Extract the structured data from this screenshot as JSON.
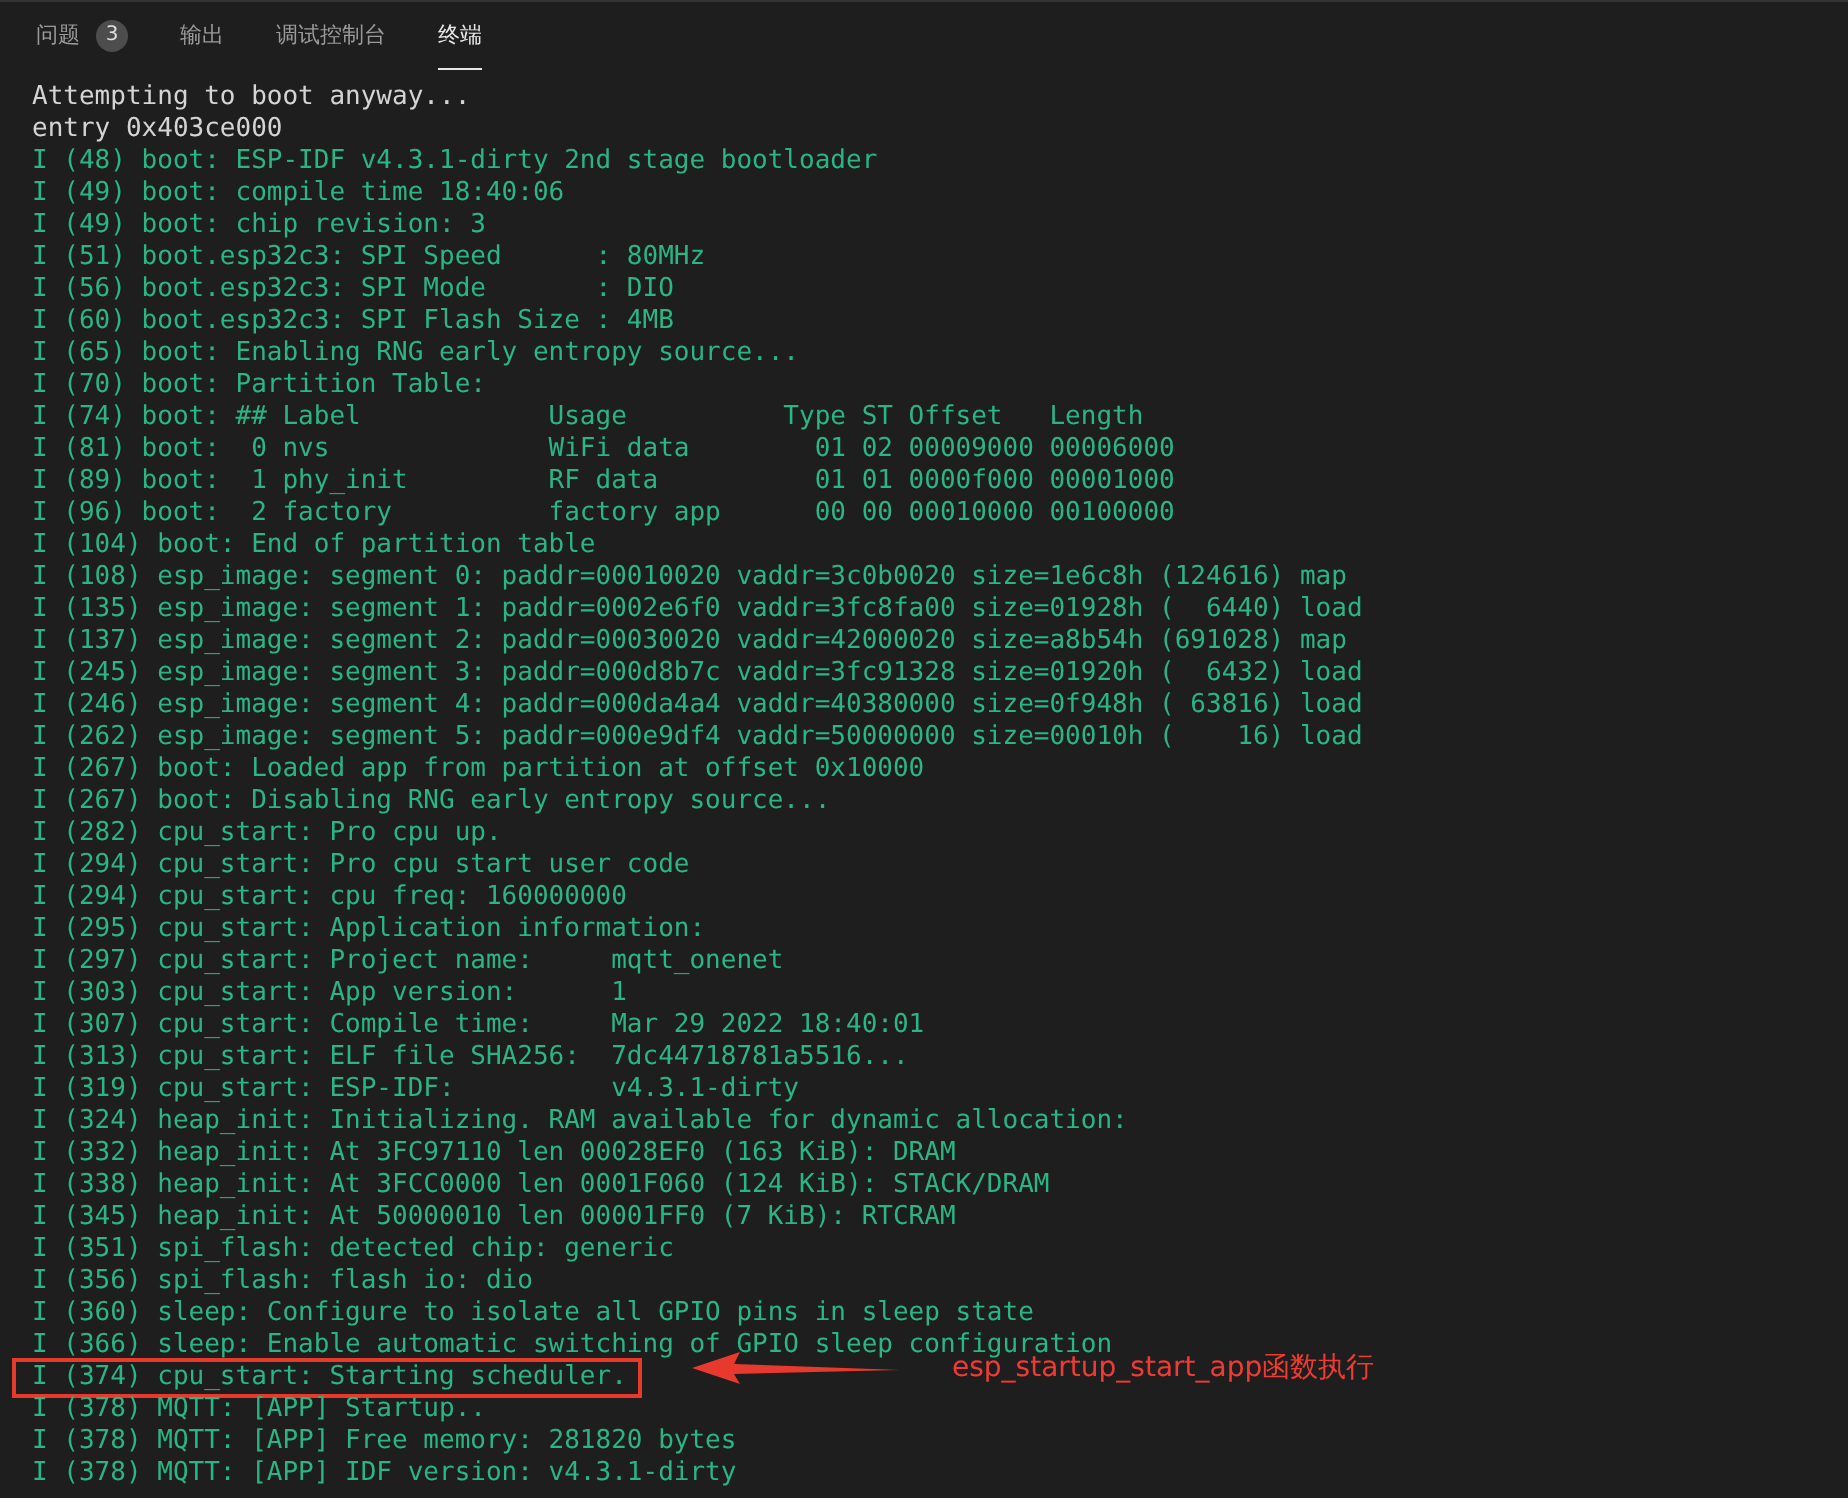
{
  "tabs": [
    {
      "label": "问题",
      "badge": "3",
      "selected": false
    },
    {
      "label": "输出",
      "selected": false
    },
    {
      "label": "调试控制台",
      "selected": false
    },
    {
      "label": "终端",
      "selected": true
    }
  ],
  "terminal": {
    "lines": [
      {
        "kind": "plain",
        "text": "Attempting to boot anyway...",
        "boxed": false
      },
      {
        "kind": "plain",
        "text": "entry 0x403ce000",
        "boxed": false
      },
      {
        "kind": "info",
        "text": "I (48) boot: ESP-IDF v4.3.1-dirty 2nd stage bootloader",
        "boxed": false
      },
      {
        "kind": "info",
        "text": "I (49) boot: compile time 18:40:06",
        "boxed": false
      },
      {
        "kind": "info",
        "text": "I (49) boot: chip revision: 3",
        "boxed": false
      },
      {
        "kind": "info",
        "text": "I (51) boot.esp32c3: SPI Speed      : 80MHz",
        "boxed": false
      },
      {
        "kind": "info",
        "text": "I (56) boot.esp32c3: SPI Mode       : DIO",
        "boxed": false
      },
      {
        "kind": "info",
        "text": "I (60) boot.esp32c3: SPI Flash Size : 4MB",
        "boxed": false
      },
      {
        "kind": "info",
        "text": "I (65) boot: Enabling RNG early entropy source...",
        "boxed": false
      },
      {
        "kind": "info",
        "text": "I (70) boot: Partition Table:",
        "boxed": false
      },
      {
        "kind": "info",
        "text": "I (74) boot: ## Label            Usage          Type ST Offset   Length",
        "boxed": false
      },
      {
        "kind": "info",
        "text": "I (81) boot:  0 nvs              WiFi data        01 02 00009000 00006000",
        "boxed": false
      },
      {
        "kind": "info",
        "text": "I (89) boot:  1 phy_init         RF data          01 01 0000f000 00001000",
        "boxed": false
      },
      {
        "kind": "info",
        "text": "I (96) boot:  2 factory          factory app      00 00 00010000 00100000",
        "boxed": false
      },
      {
        "kind": "info",
        "text": "I (104) boot: End of partition table",
        "boxed": false
      },
      {
        "kind": "info",
        "text": "I (108) esp_image: segment 0: paddr=00010020 vaddr=3c0b0020 size=1e6c8h (124616) map",
        "boxed": false
      },
      {
        "kind": "info",
        "text": "I (135) esp_image: segment 1: paddr=0002e6f0 vaddr=3fc8fa00 size=01928h (  6440) load",
        "boxed": false
      },
      {
        "kind": "info",
        "text": "I (137) esp_image: segment 2: paddr=00030020 vaddr=42000020 size=a8b54h (691028) map",
        "boxed": false
      },
      {
        "kind": "info",
        "text": "I (245) esp_image: segment 3: paddr=000d8b7c vaddr=3fc91328 size=01920h (  6432) load",
        "boxed": false
      },
      {
        "kind": "info",
        "text": "I (246) esp_image: segment 4: paddr=000da4a4 vaddr=40380000 size=0f948h ( 63816) load",
        "boxed": false
      },
      {
        "kind": "info",
        "text": "I (262) esp_image: segment 5: paddr=000e9df4 vaddr=50000000 size=00010h (    16) load",
        "boxed": false
      },
      {
        "kind": "info",
        "text": "I (267) boot: Loaded app from partition at offset 0x10000",
        "boxed": false
      },
      {
        "kind": "info",
        "text": "I (267) boot: Disabling RNG early entropy source...",
        "boxed": false
      },
      {
        "kind": "info",
        "text": "I (282) cpu_start: Pro cpu up.",
        "boxed": false
      },
      {
        "kind": "info",
        "text": "I (294) cpu_start: Pro cpu start user code",
        "boxed": false
      },
      {
        "kind": "info",
        "text": "I (294) cpu_start: cpu freq: 160000000",
        "boxed": false
      },
      {
        "kind": "info",
        "text": "I (295) cpu_start: Application information:",
        "boxed": false
      },
      {
        "kind": "info",
        "text": "I (297) cpu_start: Project name:     mqtt_onenet",
        "boxed": false
      },
      {
        "kind": "info",
        "text": "I (303) cpu_start: App version:      1",
        "boxed": false
      },
      {
        "kind": "info",
        "text": "I (307) cpu_start: Compile time:     Mar 29 2022 18:40:01",
        "boxed": false
      },
      {
        "kind": "info",
        "text": "I (313) cpu_start: ELF file SHA256:  7dc44718781a5516...",
        "boxed": false
      },
      {
        "kind": "info",
        "text": "I (319) cpu_start: ESP-IDF:          v4.3.1-dirty",
        "boxed": false
      },
      {
        "kind": "info",
        "text": "I (324) heap_init: Initializing. RAM available for dynamic allocation:",
        "boxed": false
      },
      {
        "kind": "info",
        "text": "I (332) heap_init: At 3FC97110 len 00028EF0 (163 KiB): DRAM",
        "boxed": false
      },
      {
        "kind": "info",
        "text": "I (338) heap_init: At 3FCC0000 len 0001F060 (124 KiB): STACK/DRAM",
        "boxed": false
      },
      {
        "kind": "info",
        "text": "I (345) heap_init: At 50000010 len 00001FF0 (7 KiB): RTCRAM",
        "boxed": false
      },
      {
        "kind": "info",
        "text": "I (351) spi_flash: detected chip: generic",
        "boxed": false
      },
      {
        "kind": "info",
        "text": "I (356) spi_flash: flash io: dio",
        "boxed": false
      },
      {
        "kind": "info",
        "text": "I (360) sleep: Configure to isolate all GPIO pins in sleep state",
        "boxed": false
      },
      {
        "kind": "info",
        "text": "I (366) sleep: Enable automatic switching of GPIO sleep configuration",
        "boxed": false
      },
      {
        "kind": "info",
        "text": "I (374) cpu_start: Starting scheduler.",
        "boxed": true
      },
      {
        "kind": "info",
        "text": "I (378) MQTT: [APP] Startup..",
        "boxed": false
      },
      {
        "kind": "info",
        "text": "I (378) MQTT: [APP] Free memory: 281820 bytes",
        "boxed": false
      },
      {
        "kind": "info",
        "text": "I (378) MQTT: [APP] IDF version: v4.3.1-dirty",
        "boxed": false
      }
    ]
  },
  "annotation": {
    "text": "esp_startup_start_app函数执行"
  }
}
